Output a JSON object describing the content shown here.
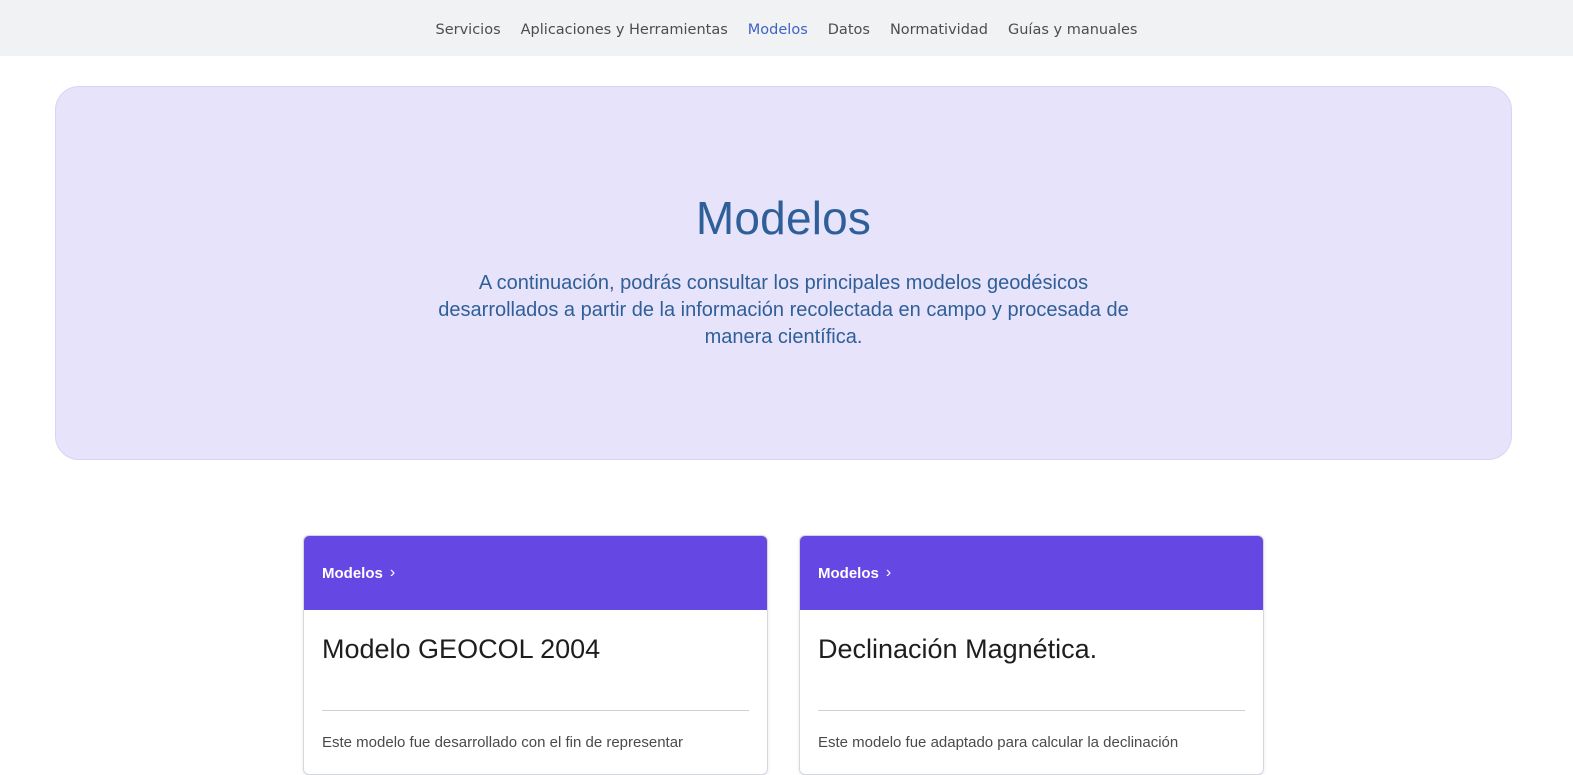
{
  "nav": {
    "items": [
      {
        "label": "Servicios",
        "active": false
      },
      {
        "label": "Aplicaciones y Herramientas",
        "active": false
      },
      {
        "label": "Modelos",
        "active": true
      },
      {
        "label": "Datos",
        "active": false
      },
      {
        "label": "Normatividad",
        "active": false
      },
      {
        "label": "Guías y manuales",
        "active": false
      }
    ]
  },
  "hero": {
    "title": "Modelos",
    "description": "A continuación, podrás consultar los principales modelos geodésicos desarrollados a partir de la información recolectada en campo y procesada de manera científica."
  },
  "cards": [
    {
      "category": "Modelos",
      "chevron": "›",
      "title": "Modelo GEOCOL 2004",
      "description": "Este modelo fue desarrollado con el fin de representar"
    },
    {
      "category": "Modelos",
      "chevron": "›",
      "title": "Declinación Magnética.",
      "description": "Este modelo fue adaptado para calcular la declinación"
    }
  ],
  "colors": {
    "nav_bg": "#f1f2f3",
    "nav_active": "#3d63c4",
    "hero_bg": "#e7e3fa",
    "hero_text": "#2f5f99",
    "card_header": "#6547e3"
  }
}
